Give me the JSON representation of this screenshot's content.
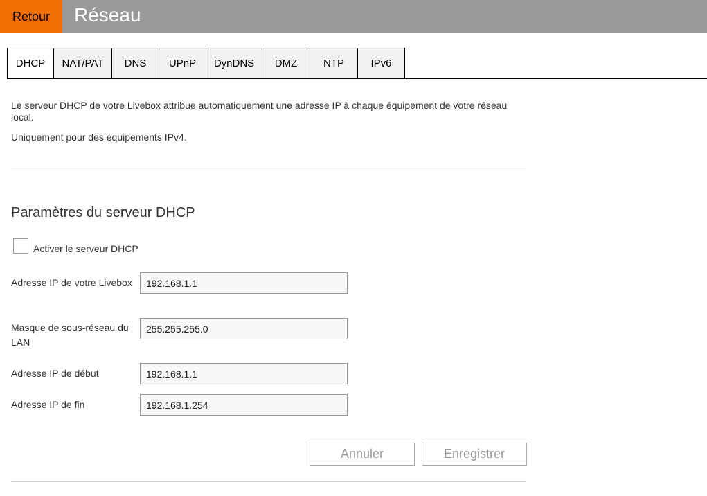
{
  "header": {
    "back_label": "Retour",
    "title": "Réseau",
    "accent_color": "#f16e00",
    "bar_color": "#999999"
  },
  "tabs": [
    {
      "label": "DHCP",
      "active": true
    },
    {
      "label": "NAT/PAT",
      "active": false
    },
    {
      "label": "DNS",
      "active": false
    },
    {
      "label": "UPnP",
      "active": false
    },
    {
      "label": "DynDNS",
      "active": false
    },
    {
      "label": "DMZ",
      "active": false
    },
    {
      "label": "NTP",
      "active": false
    },
    {
      "label": "IPv6",
      "active": false
    }
  ],
  "intro": {
    "paragraph1": "Le serveur DHCP de votre Livebox attribue automatiquement une adresse IP à chaque équipement de votre réseau local.",
    "paragraph2": "Uniquement pour des équipements IPv4."
  },
  "section": {
    "title": "Paramètres du serveur DHCP",
    "enable_label": "Activer le serveur DHCP",
    "enable_checked": false
  },
  "fields": {
    "livebox_ip": {
      "label": "Adresse IP de votre Livebox",
      "value": "192.168.1.1"
    },
    "subnet_mask": {
      "label": "Masque de sous-réseau du LAN",
      "value": "255.255.255.0"
    },
    "start_ip": {
      "label": "Adresse IP de début",
      "value": "192.168.1.1"
    },
    "end_ip": {
      "label": "Adresse IP de fin",
      "value": "192.168.1.254"
    }
  },
  "actions": {
    "cancel_label": "Annuler",
    "save_label": "Enregistrer"
  }
}
